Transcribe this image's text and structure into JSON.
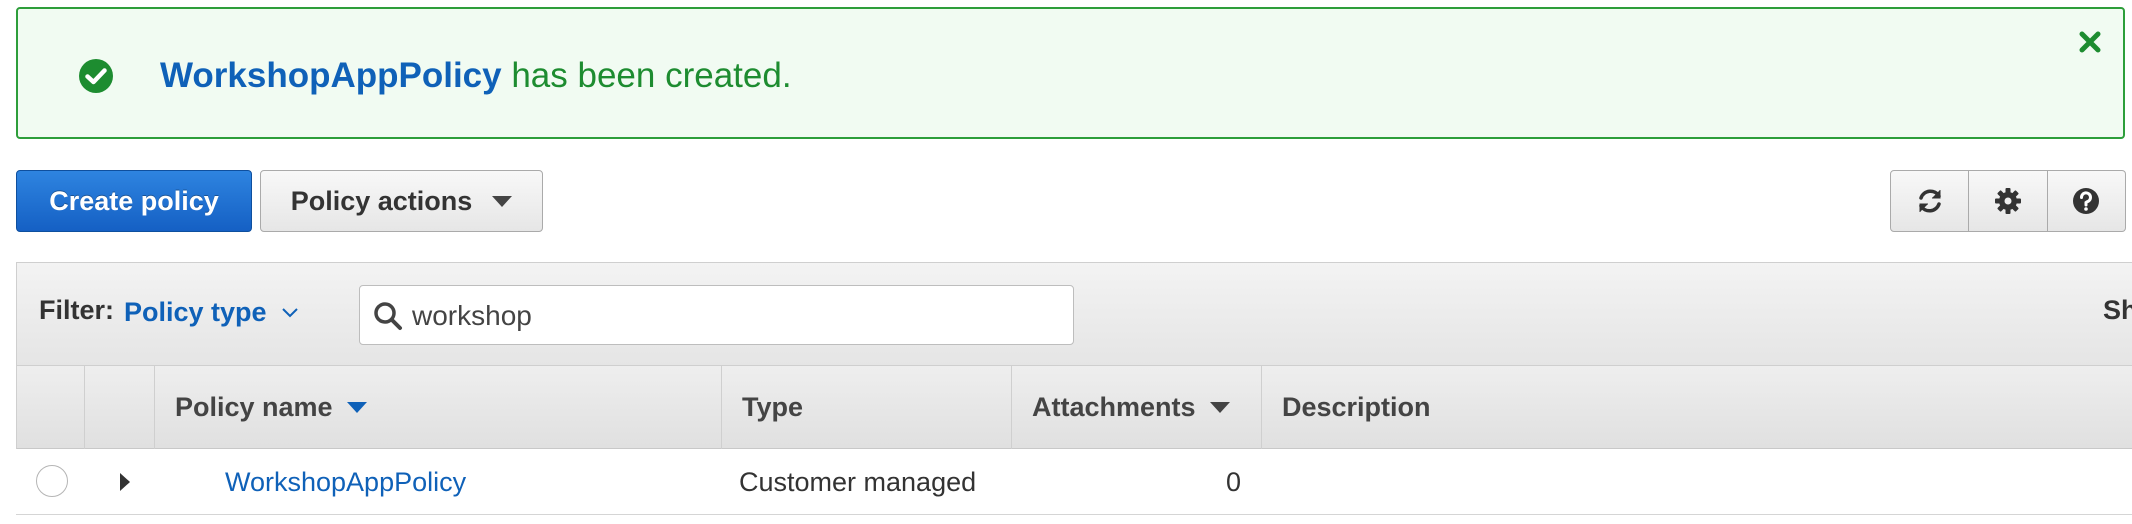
{
  "banner": {
    "policy_name": "WorkshopAppPolicy",
    "message": " has been created."
  },
  "toolbar": {
    "create_label": "Create policy",
    "actions_label": "Policy actions"
  },
  "filter": {
    "label": "Filter:",
    "type_label": "Policy type",
    "search_value": "workshop",
    "show_label": "Sh"
  },
  "table": {
    "columns": [
      "Policy name",
      "Type",
      "Attachments",
      "Description"
    ],
    "rows": [
      {
        "name": "WorkshopAppPolicy",
        "type": "Customer managed",
        "attachments": "0",
        "description": ""
      }
    ]
  },
  "colors": {
    "primary": "#1560c4",
    "link": "#0f61b8",
    "success": "#1d8c30",
    "success_border": "#2d9e3a"
  },
  "icons": [
    "check-circle-icon",
    "close-icon",
    "caret-down-icon",
    "refresh-icon",
    "gear-icon",
    "help-icon",
    "search-icon",
    "chevron-down-icon",
    "sort-caret-icon",
    "expand-arrow-icon"
  ]
}
